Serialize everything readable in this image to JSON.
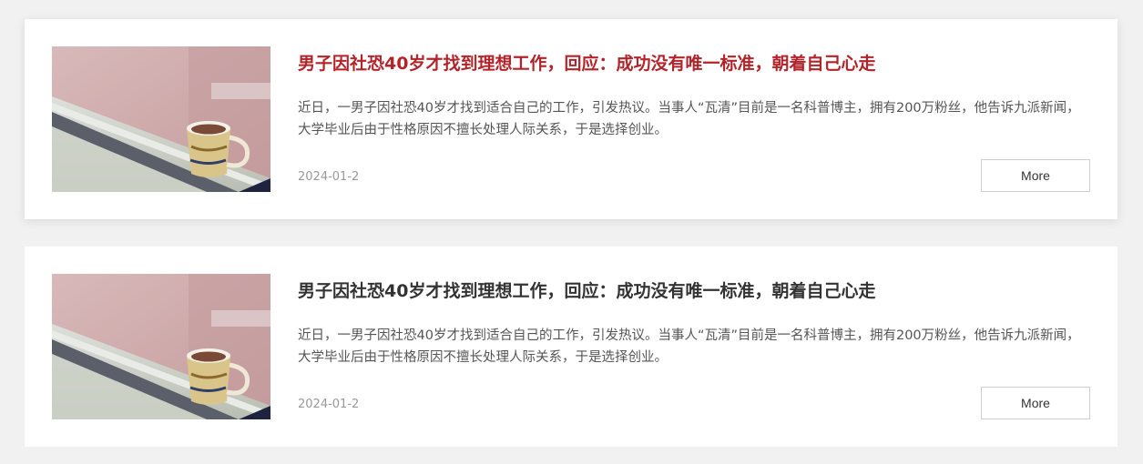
{
  "articles": [
    {
      "title": "男子因社恐40岁才找到理想工作，回应：成功没有唯一标准，朝着自己心走",
      "summary": "近日，一男子因社恐40岁才找到适合自己的工作，引发热议。当事人“瓦清”目前是一名科普博主，拥有200万粉丝，他告诉九派新闻，大学毕业后由于性格原因不擅长处理人际关系，于是选择创业。",
      "date": "2024-01-2",
      "more_label": "More",
      "thumbnail_icon": "coffee-cup-on-railing-photo",
      "title_color": "#b3242a",
      "highlighted": true
    },
    {
      "title": "男子因社恐40岁才找到理想工作，回应：成功没有唯一标准，朝着自己心走",
      "summary": "近日，一男子因社恐40岁才找到适合自己的工作，引发热议。当事人“瓦清”目前是一名科普博主，拥有200万粉丝，他告诉九派新闻，大学毕业后由于性格原因不擅长处理人际关系，于是选择创业。",
      "date": "2024-01-2",
      "more_label": "More",
      "thumbnail_icon": "coffee-cup-on-railing-photo",
      "title_color": "#333333",
      "highlighted": false
    }
  ]
}
